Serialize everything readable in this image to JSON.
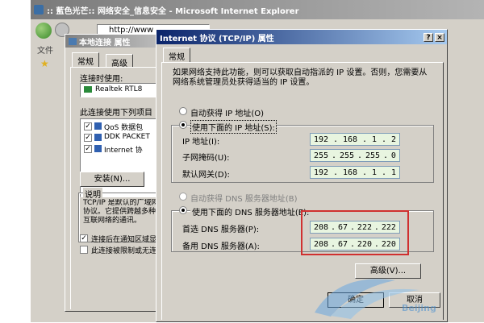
{
  "ie_window": {
    "title": ":: 藍色光芒:: 网络安全_信息安全 - Microsoft Internet Explorer",
    "address_partial": "http://www",
    "menu_partial": "文件"
  },
  "conn_dialog": {
    "title": "本地连接 属性",
    "tabs": [
      "常规",
      "高级"
    ],
    "connect_using_label": "连接时使用:",
    "adapter": "Realtek RTL8",
    "items_label": "此连接使用下列项目",
    "items": [
      {
        "label": "QoS 数据包",
        "checked": true
      },
      {
        "label": "DDK PACKET",
        "checked": true
      },
      {
        "label": "Internet 协",
        "checked": true
      }
    ],
    "install_button": "安装(N)...",
    "description_label": "说明",
    "description_text": "TCP/IP 是默认的广域网协议。它提供跨越多种互联网络的通讯。",
    "notify_checkbox": "连接后在通知区域显示图标",
    "limited_checkbox": "此连接被限制或无连接时通知我"
  },
  "tcpip_dialog": {
    "title": "Internet 协议 (TCP/IP) 属性",
    "help_button": "?",
    "close_button": "×",
    "tab": "常规",
    "intro": "如果网络支持此功能，则可以获取自动指派的 IP 设置。否则，您需要从网络系统管理员处获得适当的 IP 设置。",
    "auto_ip_label": "自动获得 IP 地址(O)",
    "manual_ip_label": "使用下面的 IP 地址(S):",
    "ip_label": "IP 地址(I):",
    "ip_value": [
      "192",
      "168",
      "1",
      "2"
    ],
    "mask_label": "子网掩码(U):",
    "mask_value": [
      "255",
      "255",
      "255",
      "0"
    ],
    "gateway_label": "默认网关(D):",
    "gateway_value": [
      "192",
      "168",
      "1",
      "1"
    ],
    "auto_dns_label": "自动获得 DNS 服务器地址(B)",
    "manual_dns_label": "使用下面的 DNS 服务器地址(E):",
    "preferred_dns_label": "首选 DNS 服务器(P):",
    "preferred_dns_value": [
      "208",
      "67",
      "222",
      "222"
    ],
    "alternate_dns_label": "备用 DNS 服务器(A):",
    "alternate_dns_value": [
      "208",
      "67",
      "220",
      "220"
    ],
    "advanced_button": "高级(V)...",
    "ok_button": "确定",
    "cancel_button": "取消"
  },
  "watermark": "Beijing",
  "colors": {
    "title_active": "#0a246a",
    "title_inactive": "#808080",
    "highlight": "#d03030",
    "ip_field_bg": "#e8f5e0"
  }
}
